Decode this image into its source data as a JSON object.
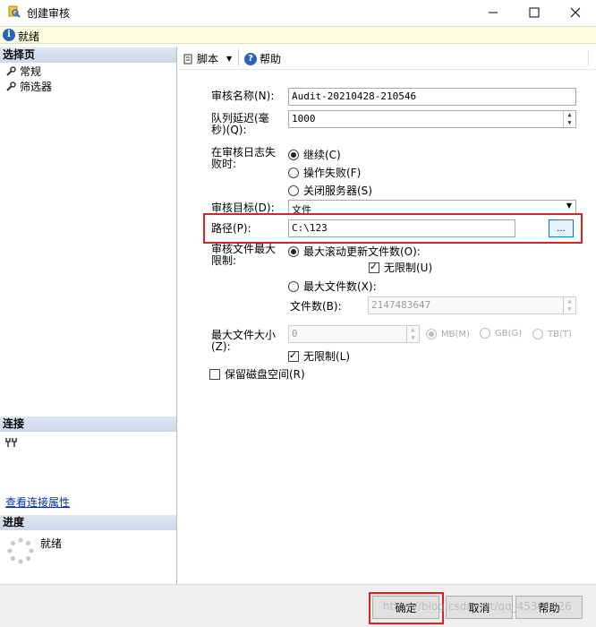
{
  "window": {
    "title": "创建审核",
    "app_icon": "audit-app-icon"
  },
  "status": {
    "text": "就绪",
    "icon": "info-icon"
  },
  "left": {
    "select_page_header": "选择页",
    "items": [
      {
        "label": "常规",
        "icon": "wrench-icon"
      },
      {
        "label": "筛选器",
        "icon": "wrench-icon"
      }
    ],
    "connection_header": "连接",
    "connection_icon": "connection-icon",
    "view_connection_link": "查看连接属性",
    "progress_header": "进度",
    "progress_status": "就绪",
    "progress_icon": "spinner-icon"
  },
  "toolbar": {
    "script_label": "脚本",
    "help_label": "帮助"
  },
  "form": {
    "audit_name_label": "审核名称(N):",
    "audit_name_value": "Audit-20210428-210546",
    "queue_delay_label_1": "队列延迟(毫",
    "queue_delay_label_2": "秒)(Q):",
    "queue_delay_value": "1000",
    "on_failure_label_1": "在审核日志失",
    "on_failure_label_2": "败时:",
    "on_failure_options": [
      "继续(C)",
      "操作失败(F)",
      "关闭服务器(S)"
    ],
    "audit_dest_label": "审核目标(D):",
    "audit_dest_value": "文件",
    "path_label": "路径(P):",
    "path_value": "C:\\123",
    "browse_label": "...",
    "max_limit_label_1": "审核文件最大",
    "max_limit_label_2": "限制:",
    "max_rollover_label": "最大滚动更新文件数(O):",
    "unlimited_label": "无限制(U)",
    "max_files_label": "最大文件数(X):",
    "file_count_label": "文件数(B):",
    "file_count_value": "2147483647",
    "max_size_label_1": "最大文件大小",
    "max_size_label_2": "(Z):",
    "max_size_value": "0",
    "size_units": [
      "MB(M)",
      "GB(G)",
      "TB(T)"
    ],
    "size_unlimited_label": "无限制(L)",
    "reserve_disk_label": "保留磁盘空间(R)"
  },
  "buttons": {
    "ok": "确定",
    "cancel": "取消",
    "help": "帮助"
  },
  "watermark": "https://blog.csdn.net/qq_45361026",
  "colors": {
    "highlight_box": "#e02020",
    "link": "#0033aa",
    "status_bg": "#ffffe1"
  }
}
